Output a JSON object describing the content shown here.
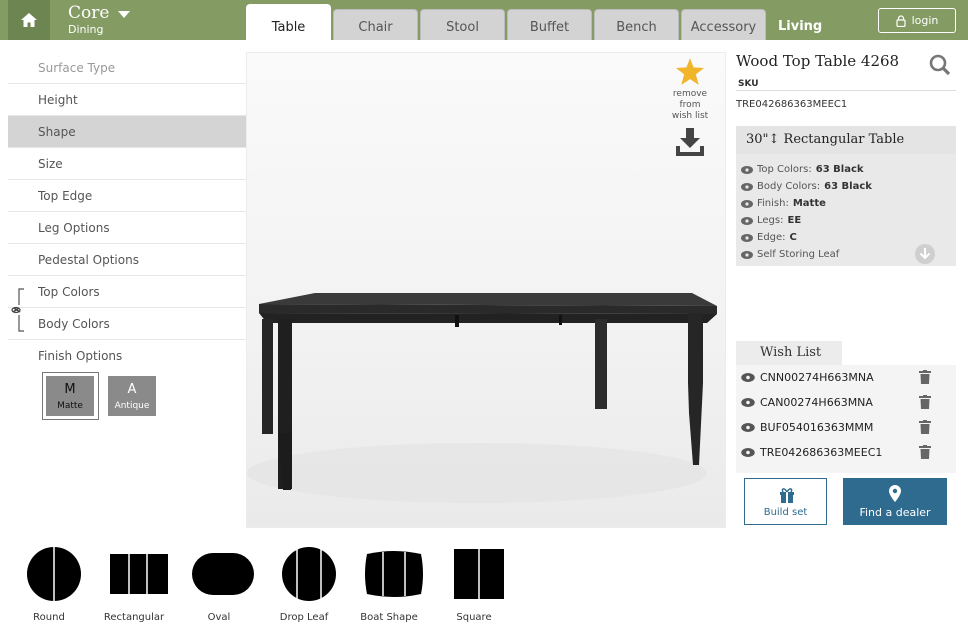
{
  "header": {
    "brand_title": "Core",
    "brand_sub": "Dining",
    "tabs": [
      {
        "label": "Table",
        "active": true
      },
      {
        "label": "Chair",
        "active": false
      },
      {
        "label": "Stool",
        "active": false
      },
      {
        "label": "Buffet",
        "active": false
      },
      {
        "label": "Bench",
        "active": false
      },
      {
        "label": "Accessory",
        "active": false
      }
    ],
    "living_label": "Living",
    "login_label": "login",
    "accent_color": "#849c63"
  },
  "sidebar": {
    "items": [
      {
        "label": "Surface Type",
        "state": "muted"
      },
      {
        "label": "Height",
        "state": "normal"
      },
      {
        "label": "Shape",
        "state": "selected"
      },
      {
        "label": "Size",
        "state": "normal"
      },
      {
        "label": "Top Edge",
        "state": "normal"
      },
      {
        "label": "Leg Options",
        "state": "normal"
      },
      {
        "label": "Pedestal Options",
        "state": "normal"
      },
      {
        "label": "Top Colors",
        "state": "normal"
      },
      {
        "label": "Body Colors",
        "state": "normal"
      },
      {
        "label": "Finish Options",
        "state": "normal"
      }
    ],
    "finish_options": [
      {
        "letter": "M",
        "label": "Matte",
        "selected": true
      },
      {
        "letter": "A",
        "label": "Antique",
        "selected": false
      }
    ]
  },
  "viewer": {
    "wishlist_action": "remove from wish list"
  },
  "product": {
    "title": "Wood Top Table 4268",
    "sku_label": "SKU",
    "sku": "TRE042686363MEEC1",
    "config_title": "30\"↕ Rectangular Table",
    "attributes": [
      {
        "label": "Top Colors: ",
        "value": "63 Black"
      },
      {
        "label": "Body Colors: ",
        "value": "63 Black"
      },
      {
        "label": "Finish: ",
        "value": "Matte"
      },
      {
        "label": "Legs: ",
        "value": "EE"
      },
      {
        "label": "Edge: ",
        "value": "C"
      },
      {
        "label": "Self Storing Leaf",
        "value": ""
      }
    ]
  },
  "wishlist": {
    "title": "Wish List",
    "items": [
      "CNN00274H663MNA",
      "CAN00274H663MNA",
      "BUF054016363MMM",
      "TRE042686363MEEC1"
    ]
  },
  "actions": {
    "build_label": "Build set",
    "dealer_label": "Find a dealer",
    "primary_color": "#2e6b8f"
  },
  "shapes": [
    {
      "label": "Round",
      "icon": "round-table-icon"
    },
    {
      "label": "Rectangular",
      "icon": "rectangular-table-icon"
    },
    {
      "label": "Oval",
      "icon": "oval-table-icon"
    },
    {
      "label": "Drop Leaf",
      "icon": "drop-leaf-table-icon"
    },
    {
      "label": "Boat Shape",
      "icon": "boat-shape-table-icon"
    },
    {
      "label": "Square",
      "icon": "square-table-icon"
    }
  ]
}
